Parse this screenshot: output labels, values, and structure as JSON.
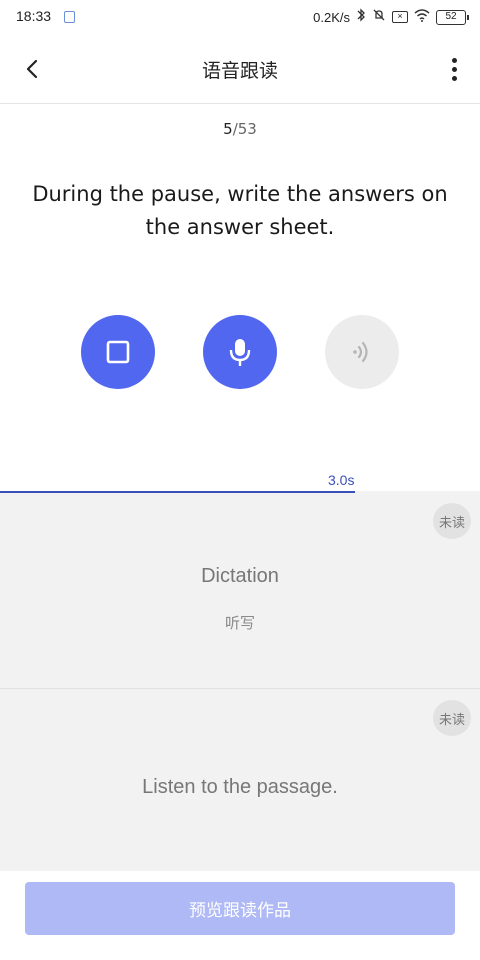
{
  "status_bar": {
    "time": "18:33",
    "network_speed": "0.2K/s",
    "battery": "52",
    "icons": [
      "notification-icon",
      "bluetooth-icon",
      "mute-icon",
      "sim-icon",
      "wifi-icon",
      "battery-icon"
    ]
  },
  "header": {
    "title": "语音跟读",
    "back_icon": "chevron-left-icon",
    "more_icon": "more-vertical-icon"
  },
  "progress": {
    "current": "5",
    "separator": "/",
    "total": "53"
  },
  "sentence": "During the pause, write the answers on the answer sheet.",
  "controls": {
    "stop_icon": "stop-icon",
    "mic_icon": "microphone-icon",
    "play_icon": "audio-wave-icon",
    "accent_color": "#5167f0",
    "disabled_color": "#ececec"
  },
  "timer": {
    "label": "3.0s",
    "fraction": 0.74
  },
  "cards": [
    {
      "badge": "未读",
      "title": "Dictation",
      "subtitle": "听写"
    },
    {
      "badge": "未读",
      "title": "Listen to the passage."
    }
  ],
  "footer": {
    "preview_label": "预览跟读作品",
    "button_color": "#afb9f5"
  }
}
